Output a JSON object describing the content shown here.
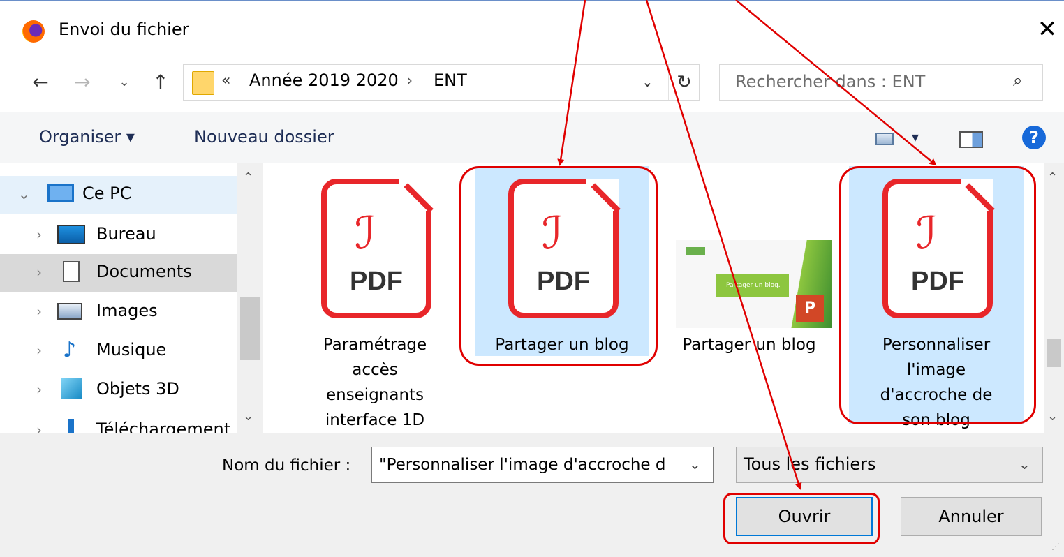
{
  "window": {
    "title": "Envoi du fichier",
    "close_glyph": "✕"
  },
  "nav": {
    "back": "←",
    "forward": "→",
    "recent": "⌄",
    "up": "↑"
  },
  "address": {
    "overflow": "«",
    "crumbs": [
      "Année 2019 2020",
      "ENT"
    ],
    "separator": "›",
    "dropdown": "⌄",
    "refresh": "↻"
  },
  "search": {
    "placeholder": "Rechercher dans : ENT",
    "icon": "⌕"
  },
  "toolbar": {
    "organize": "Organiser ▾",
    "new_folder": "Nouveau dossier",
    "view_dropdown": "▾",
    "help": "?"
  },
  "nav_pane": {
    "items": [
      {
        "chev": "⌄",
        "label": "Ce PC",
        "icon": "computer-icon"
      },
      {
        "chev": "›",
        "label": "Bureau",
        "icon": "desktop-icon"
      },
      {
        "chev": "›",
        "label": "Documents",
        "icon": "documents-icon"
      },
      {
        "chev": "›",
        "label": "Images",
        "icon": "images-icon"
      },
      {
        "chev": "›",
        "label": "Musique",
        "icon": "music-icon"
      },
      {
        "chev": "›",
        "label": "Objets 3D",
        "icon": "objects3d-icon"
      },
      {
        "chev": "›",
        "label": "Téléchargement",
        "icon": "downloads-icon"
      }
    ],
    "scroll_up": "⌃",
    "scroll_down": "⌄"
  },
  "files": [
    {
      "name": "Paramétrage accès enseignants interface 1D",
      "type": "pdf",
      "selected": false
    },
    {
      "name": "Partager un blog",
      "type": "pdf",
      "selected": true
    },
    {
      "name": "Partager un blog",
      "type": "pptx",
      "selected": false
    },
    {
      "name": "Personnaliser l'image d'accroche de son blog",
      "type": "pdf",
      "selected": true
    }
  ],
  "file_icon": {
    "acrobat_glyph": "ℐ",
    "pdf_label": "PDF",
    "ppt_label": "P"
  },
  "ppt_thumb_text": "Partager un blog.",
  "file_scroll": {
    "up": "⌃",
    "down": "⌄"
  },
  "footer": {
    "filename_label": "Nom du fichier :",
    "filename_value": "\"Personnaliser l'image d'accroche d",
    "filename_drop": "⌄",
    "filetype_value": "Tous les fichiers",
    "filetype_drop": "⌄",
    "open_button": "Ouvrir",
    "cancel_button": "Annuler"
  },
  "colors": {
    "annotation": "#e00000",
    "selection": "#cce8ff",
    "focus": "#0078d7"
  }
}
